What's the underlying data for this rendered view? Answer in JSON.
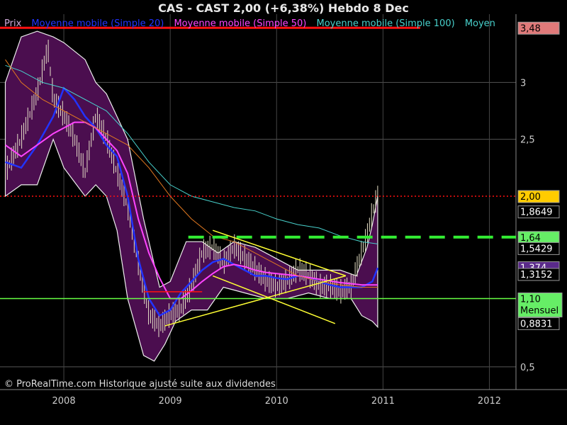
{
  "header": {
    "title": "CAS - CAST     2,00 (+6,38%)     Hebdo  8 Dec"
  },
  "legend": {
    "items": [
      {
        "label": "Prix",
        "color": "#cfa8d8"
      },
      {
        "label": "Moyenne mobile (Simple 20)",
        "color": "#2233ff"
      },
      {
        "label": "Moyenne mobile (Simple 50)",
        "color": "#ff44ff"
      },
      {
        "label": "Moyenne mobile (Simple 100)",
        "color": "#48d1cc"
      },
      {
        "label": "Moyen",
        "color": "#48d1cc"
      }
    ]
  },
  "footer": {
    "credit": "© ProRealTime.com Historique ajusté suite aux dividendes"
  },
  "colors": {
    "background": "#000000",
    "band_fill": "#4b0e4f",
    "price_bar": "#e8e2c8",
    "ma20": "#2233ff",
    "ma50": "#ff44ff",
    "ma100": "#48d1cc",
    "ma_long": "#e07820",
    "resistance": "#ff1111",
    "support": "#66ff44",
    "dashed_line": "#33ee33",
    "channel": "#ffff33"
  },
  "chart_data": {
    "type": "line",
    "title": "CAS - CAST",
    "ylim": [
      0.3,
      3.6
    ],
    "xlim": [
      2007.4,
      2012.25
    ],
    "x_ticks": [
      {
        "value": 2008,
        "label": "2008"
      },
      {
        "value": 2009,
        "label": "2009"
      },
      {
        "value": 2010,
        "label": "2010"
      },
      {
        "value": 2011,
        "label": "2011"
      },
      {
        "value": 2012,
        "label": "2012"
      }
    ],
    "y_ticks": [
      {
        "value": 3,
        "label": "3"
      },
      {
        "value": 2.5,
        "label": "2,5"
      },
      {
        "value": 0.5,
        "label": "0,5"
      }
    ],
    "grid": true,
    "price": {
      "x": [
        2007.45,
        2007.6,
        2007.75,
        2007.85,
        2007.9,
        2008.0,
        2008.1,
        2008.2,
        2008.3,
        2008.4,
        2008.5,
        2008.6,
        2008.7,
        2008.8,
        2008.9,
        2009.0,
        2009.1,
        2009.2,
        2009.3,
        2009.4,
        2009.5,
        2009.6,
        2009.7,
        2009.8,
        2009.9,
        2010.0,
        2010.1,
        2010.2,
        2010.3,
        2010.4,
        2010.5,
        2010.6,
        2010.7,
        2010.8,
        2010.85,
        2010.9,
        2010.95
      ],
      "y": [
        2.2,
        2.5,
        2.9,
        3.3,
        2.85,
        2.7,
        2.5,
        2.2,
        2.7,
        2.5,
        2.2,
        1.9,
        1.4,
        0.95,
        0.85,
        0.95,
        1.0,
        1.2,
        1.5,
        1.55,
        1.4,
        1.55,
        1.45,
        1.35,
        1.25,
        1.2,
        1.25,
        1.35,
        1.3,
        1.2,
        1.2,
        1.15,
        1.2,
        1.5,
        1.65,
        1.85,
        2.0
      ]
    },
    "bollinger_upper": {
      "x": [
        2007.45,
        2007.6,
        2007.75,
        2007.9,
        2008.0,
        2008.2,
        2008.3,
        2008.4,
        2008.5,
        2008.6,
        2008.75,
        2008.9,
        2009.0,
        2009.15,
        2009.3,
        2009.45,
        2009.6,
        2009.8,
        2010.0,
        2010.2,
        2010.4,
        2010.6,
        2010.75,
        2010.85,
        2010.9,
        2010.95
      ],
      "y": [
        3.0,
        3.4,
        3.45,
        3.4,
        3.35,
        3.2,
        3.0,
        2.9,
        2.7,
        2.5,
        1.8,
        1.2,
        1.25,
        1.6,
        1.6,
        1.5,
        1.6,
        1.55,
        1.45,
        1.35,
        1.35,
        1.35,
        1.3,
        1.55,
        1.75,
        2.0
      ]
    },
    "bollinger_lower": {
      "x": [
        2007.45,
        2007.6,
        2007.75,
        2007.9,
        2008.0,
        2008.2,
        2008.3,
        2008.4,
        2008.5,
        2008.6,
        2008.75,
        2008.85,
        2008.95,
        2009.05,
        2009.2,
        2009.35,
        2009.5,
        2009.7,
        2009.9,
        2010.1,
        2010.3,
        2010.5,
        2010.7,
        2010.8,
        2010.9,
        2010.95
      ],
      "y": [
        2.0,
        2.1,
        2.1,
        2.5,
        2.25,
        2.0,
        2.1,
        2.0,
        1.7,
        1.1,
        0.6,
        0.55,
        0.7,
        0.9,
        1.0,
        1.0,
        1.2,
        1.15,
        1.1,
        1.1,
        1.15,
        1.1,
        1.1,
        0.95,
        0.9,
        0.85
      ]
    },
    "series": [
      {
        "name": "Moyenne mobile (Simple 20)",
        "x": [
          2007.45,
          2007.6,
          2007.75,
          2007.9,
          2008.0,
          2008.1,
          2008.2,
          2008.3,
          2008.4,
          2008.5,
          2008.6,
          2008.7,
          2008.8,
          2008.9,
          2009.0,
          2009.1,
          2009.2,
          2009.3,
          2009.4,
          2009.5,
          2009.6,
          2009.7,
          2009.8,
          2009.9,
          2010.0,
          2010.1,
          2010.2,
          2010.3,
          2010.4,
          2010.5,
          2010.6,
          2010.7,
          2010.8,
          2010.9,
          2010.95
        ],
        "y": [
          2.3,
          2.25,
          2.45,
          2.7,
          2.95,
          2.85,
          2.7,
          2.6,
          2.45,
          2.35,
          2.0,
          1.45,
          1.1,
          0.95,
          1.0,
          1.15,
          1.25,
          1.35,
          1.42,
          1.45,
          1.4,
          1.35,
          1.3,
          1.3,
          1.28,
          1.27,
          1.3,
          1.28,
          1.25,
          1.22,
          1.2,
          1.2,
          1.2,
          1.25,
          1.37
        ]
      },
      {
        "name": "Moyenne mobile (Simple 50)",
        "x": [
          2007.45,
          2007.6,
          2007.75,
          2007.9,
          2008.0,
          2008.1,
          2008.2,
          2008.3,
          2008.4,
          2008.5,
          2008.6,
          2008.7,
          2008.8,
          2008.9,
          2009.0,
          2009.1,
          2009.2,
          2009.3,
          2009.4,
          2009.5,
          2009.6,
          2009.7,
          2009.8,
          2009.9,
          2010.0,
          2010.2,
          2010.4,
          2010.6,
          2010.8,
          2010.95
        ],
        "y": [
          2.45,
          2.35,
          2.45,
          2.55,
          2.6,
          2.65,
          2.65,
          2.6,
          2.5,
          2.4,
          2.2,
          1.8,
          1.5,
          1.28,
          1.1,
          1.1,
          1.17,
          1.25,
          1.32,
          1.38,
          1.4,
          1.38,
          1.35,
          1.33,
          1.32,
          1.3,
          1.27,
          1.24,
          1.22,
          1.22
        ]
      },
      {
        "name": "Moyenne mobile (Simple 100)",
        "x": [
          2007.45,
          2007.6,
          2007.8,
          2008.0,
          2008.2,
          2008.4,
          2008.6,
          2008.8,
          2009.0,
          2009.2,
          2009.4,
          2009.6,
          2009.8,
          2010.0,
          2010.2,
          2010.4,
          2010.6,
          2010.8,
          2010.95
        ],
        "y": [
          3.15,
          3.1,
          3.0,
          2.95,
          2.85,
          2.75,
          2.55,
          2.3,
          2.1,
          2.0,
          1.95,
          1.9,
          1.87,
          1.8,
          1.75,
          1.72,
          1.65,
          1.6,
          1.58
        ]
      },
      {
        "name": "Moyen",
        "x": [
          2007.45,
          2007.6,
          2007.8,
          2008.0,
          2008.2,
          2008.4,
          2008.6,
          2008.8,
          2009.0,
          2009.2,
          2009.4,
          2009.6,
          2009.8,
          2010.0,
          2010.2,
          2010.4,
          2010.6,
          2010.8,
          2010.95
        ],
        "y": [
          3.2,
          3.0,
          2.85,
          2.75,
          2.65,
          2.55,
          2.45,
          2.25,
          2.0,
          1.8,
          1.65,
          1.6,
          1.5,
          1.4,
          1.3,
          1.25,
          1.22,
          1.2,
          1.2
        ]
      }
    ],
    "horizontal_lines": [
      {
        "name": "resistance-line",
        "y": 3.48,
        "color": "#ff1111",
        "style": "solid",
        "x_from": 2007.4,
        "x_to": 2011.35
      },
      {
        "name": "last-price-line",
        "y": 2.0,
        "color": "#ff1111",
        "style": "dotted",
        "x_from": 2007.4,
        "x_to": 2012.25
      },
      {
        "name": "dashed-target-line",
        "y": 1.64,
        "color": "#33ee33",
        "style": "dashed",
        "x_from": 2009.17,
        "x_to": 2012.25
      },
      {
        "name": "support-line",
        "y": 1.1,
        "color": "#66ff44",
        "style": "solid",
        "x_from": 2007.4,
        "x_to": 2012.25
      },
      {
        "name": "red-segment",
        "y": 1.16,
        "color": "#ff1111",
        "style": "solid",
        "x_from": 2008.75,
        "x_to": 2009.3
      }
    ],
    "trend_lines": [
      {
        "name": "channel-upper",
        "x1": 2009.4,
        "y1": 1.7,
        "x2": 2010.65,
        "y2": 1.3
      },
      {
        "name": "channel-lower",
        "x1": 2009.4,
        "y1": 1.3,
        "x2": 2010.55,
        "y2": 0.88
      },
      {
        "name": "rising-trendline",
        "x1": 2008.95,
        "y1": 0.86,
        "x2": 2010.65,
        "y2": 1.3
      }
    ],
    "price_tags": [
      {
        "label": "3,48",
        "value": 3.48,
        "bg": "#e07a7a",
        "fg": "#000000"
      },
      {
        "label": "2,00",
        "value": 2.0,
        "bg": "#ffcc00",
        "fg": "#000000"
      },
      {
        "label": "1,8649",
        "value": 1.8649,
        "bg": "#000000",
        "fg": "#ffffff"
      },
      {
        "label": "1,64",
        "value": 1.64,
        "bg": "#66ee66",
        "fg": "#000000"
      },
      {
        "label": "1,5429",
        "value": 1.5429,
        "bg": "#000000",
        "fg": "#ffffff"
      },
      {
        "label": "1,374",
        "value": 1.374,
        "bg": "#5a2a8a",
        "fg": "#ffffff"
      },
      {
        "label": "1,3152",
        "value": 1.3152,
        "bg": "#000000",
        "fg": "#ffffff"
      },
      {
        "label": "1,10",
        "value": 1.1,
        "bg": "#66ee66",
        "fg": "#000000",
        "sub": "Mensuel"
      },
      {
        "label": "0,8831",
        "value": 0.8831,
        "bg": "#000000",
        "fg": "#ffffff"
      }
    ]
  }
}
